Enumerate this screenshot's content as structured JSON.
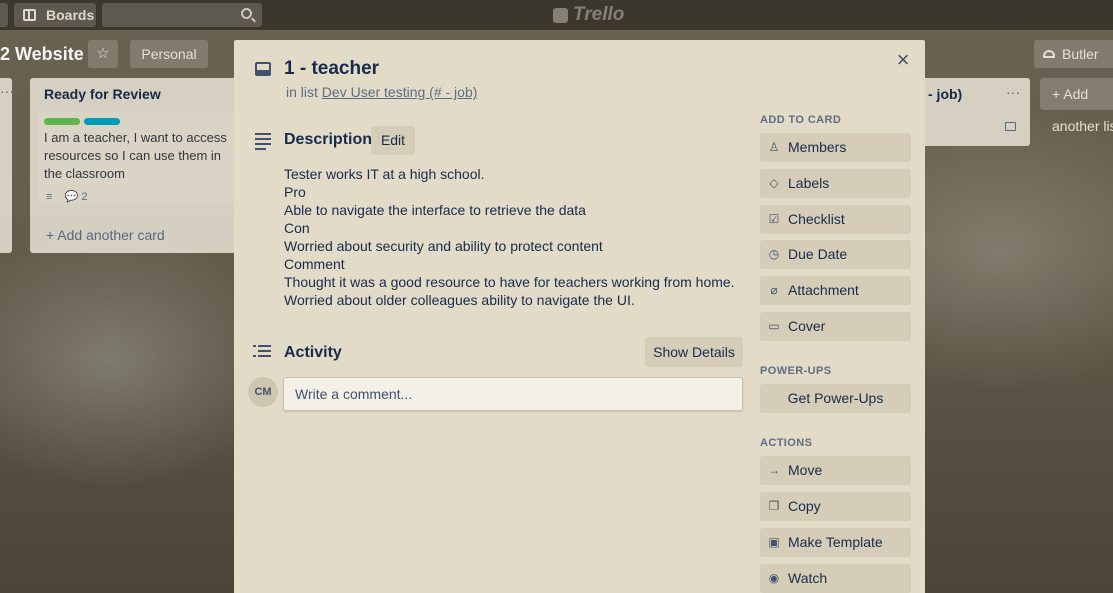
{
  "topbar": {
    "boards_label": "Boards",
    "logo_text": "Trello"
  },
  "board": {
    "title": "2 Website",
    "personal_label": "Personal",
    "butler_label": "Butler"
  },
  "lists": {
    "left_dots": "···",
    "review": {
      "title": "Ready for Review",
      "card_text": "I am a teacher, I want to access resources so I can use them in the classroom",
      "comment_count": "2",
      "add_card": "+ Add another card"
    },
    "right": {
      "title": "- job)",
      "dots": "···"
    },
    "add_list": "+ Add another list"
  },
  "card": {
    "title": "1 - teacher",
    "in_list_prefix": "in list",
    "list_name": "Dev User testing (# - job)",
    "close": "×",
    "description": {
      "heading": "Description",
      "edit_label": "Edit",
      "lines": [
        "Tester works IT at a high school.",
        "Pro",
        "Able to navigate the interface to retrieve the data",
        "Con",
        "Worried about security and ability to protect content",
        "Comment",
        "Thought it was a good resource to have for teachers working from home.",
        "Worried about older colleagues ability to navigate the UI."
      ]
    },
    "activity": {
      "heading": "Activity",
      "show_details": "Show Details",
      "avatar_initials": "CM",
      "comment_placeholder": "Write a comment..."
    }
  },
  "sidebar": {
    "add_to_card": {
      "heading": "ADD TO CARD",
      "items": [
        {
          "label": "Members",
          "icon": "user-icon"
        },
        {
          "label": "Labels",
          "icon": "tag-icon"
        },
        {
          "label": "Checklist",
          "icon": "checklist-icon"
        },
        {
          "label": "Due Date",
          "icon": "clock-icon"
        },
        {
          "label": "Attachment",
          "icon": "paperclip-icon"
        },
        {
          "label": "Cover",
          "icon": "cover-icon"
        }
      ]
    },
    "power_ups": {
      "heading": "POWER-UPS",
      "button": "Get Power-Ups"
    },
    "actions": {
      "heading": "ACTIONS",
      "items": [
        {
          "label": "Move",
          "icon": "arrow-right-icon"
        },
        {
          "label": "Copy",
          "icon": "copy-icon"
        },
        {
          "label": "Make Template",
          "icon": "template-icon"
        },
        {
          "label": "Watch",
          "icon": "eye-icon"
        }
      ]
    }
  },
  "colors": {
    "modal_bg": "#e2dbc7",
    "button_bg": "#d5cdb8",
    "label_green": "#61bd4f",
    "label_teal": "#00a3bf"
  }
}
